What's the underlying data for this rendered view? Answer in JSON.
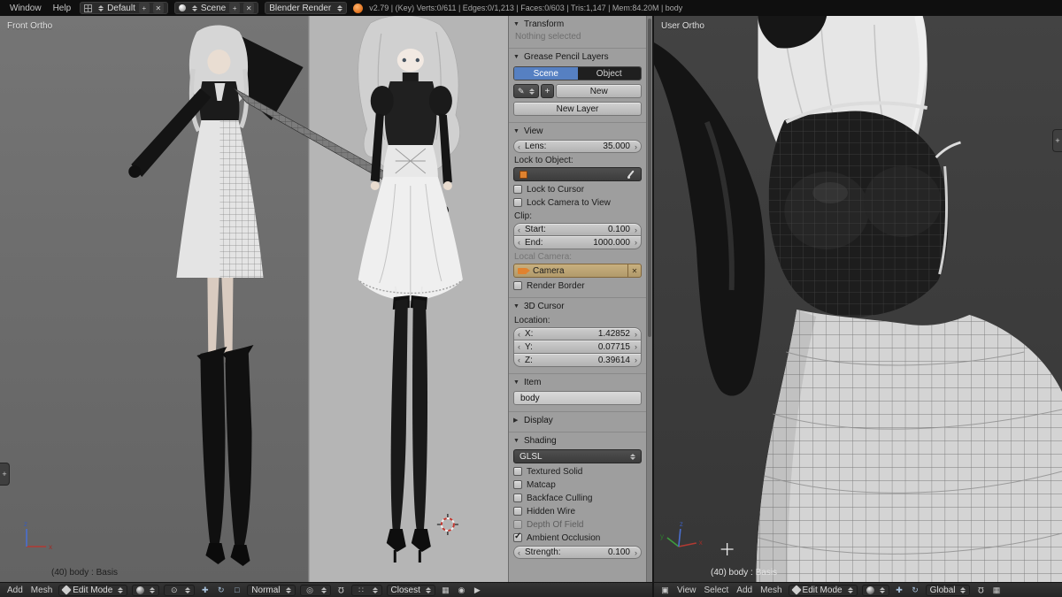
{
  "colors": {
    "accent": "#5680c2",
    "object_orange": "#e0822f"
  },
  "topbar": {
    "menus": [
      "Window",
      "Help"
    ],
    "layout_name": "Default",
    "scene_name": "Scene",
    "engine": "Blender Render",
    "stats": "v2.79 | (Key) Verts:0/611 | Edges:0/1,213 | Faces:0/603 | Tris:1,147 | Mem:84.20M | body"
  },
  "left_viewport": {
    "label": "Front Ortho",
    "status": "(40) body : Basis"
  },
  "right_viewport": {
    "label": "User Ortho",
    "status": "(40) body : Basis"
  },
  "panel": {
    "transform": {
      "title": "Transform",
      "empty": "Nothing selected"
    },
    "gpencil": {
      "title": "Grease Pencil Layers",
      "tab_scene": "Scene",
      "tab_object": "Object",
      "new_button": "New",
      "new_layer_button": "New Layer"
    },
    "view": {
      "title": "View",
      "lens_label": "Lens:",
      "lens_value": "35.000",
      "lock_object_label": "Lock to Object:",
      "lock_cursor_label": "Lock to Cursor",
      "lock_camera_label": "Lock Camera to View",
      "clip_label": "Clip:",
      "start_label": "Start:",
      "start_value": "0.100",
      "end_label": "End:",
      "end_value": "1000.000",
      "local_camera_label": "Local Camera:",
      "camera_value": "Camera",
      "render_border_label": "Render Border"
    },
    "cursor": {
      "title": "3D Cursor",
      "location_label": "Location:",
      "x_label": "X:",
      "x_value": "1.42852",
      "y_label": "Y:",
      "y_value": "0.07715",
      "z_label": "Z:",
      "z_value": "0.39614"
    },
    "item": {
      "title": "Item",
      "name_value": "body"
    },
    "display": {
      "title": "Display"
    },
    "shading": {
      "title": "Shading",
      "mode": "GLSL",
      "options": [
        {
          "label": "Textured Solid",
          "checked": false
        },
        {
          "label": "Matcap",
          "checked": false
        },
        {
          "label": "Backface Culling",
          "checked": false
        },
        {
          "label": "Hidden Wire",
          "checked": false
        },
        {
          "label": "Depth Of Field",
          "checked": false
        },
        {
          "label": "Ambient Occlusion",
          "checked": true
        }
      ],
      "strength_label": "Strength:",
      "strength_value": "0.100"
    }
  },
  "left_footer": {
    "menu_add": "Add",
    "menu_mesh": "Mesh",
    "mode": "Edit Mode",
    "orientation": "Normal",
    "snap_target": "Closest"
  },
  "right_footer": {
    "menu_view": "View",
    "menu_select": "Select",
    "menu_add": "Add",
    "menu_mesh": "Mesh",
    "mode": "Edit Mode",
    "orientation": "Global"
  }
}
